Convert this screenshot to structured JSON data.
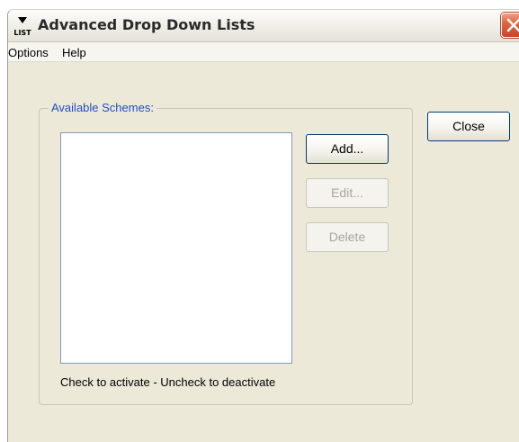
{
  "window": {
    "title": "Advanced Drop Down Lists",
    "icon_label": "LIST",
    "icon_name": "list-app-icon",
    "close_icon": "close-icon"
  },
  "menu": {
    "items": [
      {
        "label": "Options"
      },
      {
        "label": "Help"
      }
    ]
  },
  "schemes": {
    "group_label": "Available Schemes:",
    "items": [],
    "hint": "Check to activate - Uncheck to deactivate"
  },
  "buttons": {
    "add": "Add...",
    "edit": "Edit...",
    "delete": "Delete",
    "close": "Close"
  },
  "colors": {
    "group_label": "#1f4fbf",
    "window_bg": "#ece9d8",
    "close_button_red": "#e2643f"
  }
}
